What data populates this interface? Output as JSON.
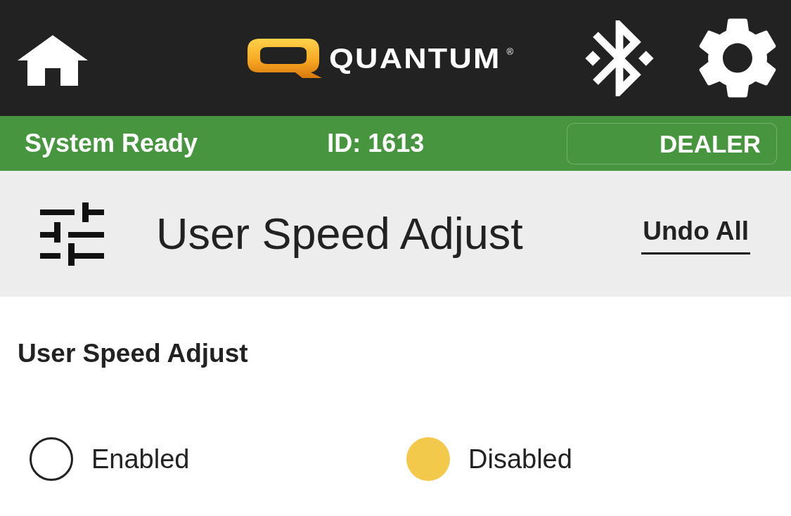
{
  "header": {
    "logo": {
      "text": "QUANTUM",
      "mark": "®"
    }
  },
  "status_bar": {
    "status": "System Ready",
    "id": "ID: 1613",
    "mode_button": "DEALER"
  },
  "title_bar": {
    "title": "User Speed Adjust",
    "action": "Undo All"
  },
  "setting": {
    "label": "User Speed Adjust",
    "options": [
      {
        "label": "Enabled",
        "selected": false
      },
      {
        "label": "Disabled",
        "selected": true
      }
    ]
  }
}
